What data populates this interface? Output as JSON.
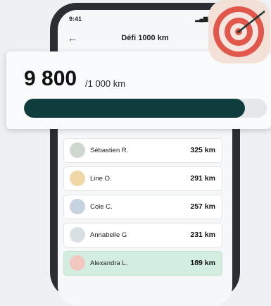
{
  "status": {
    "time": "9:41",
    "icons": "▂▄▆ ≋ ▭"
  },
  "nav": {
    "back": "←",
    "title": "Défi 1000 km"
  },
  "progress": {
    "value": "9 800",
    "total": "/1 000 km",
    "fill_fraction": 0.91
  },
  "leaderboard": [
    {
      "name": "Sébastien R.",
      "km": "325 km",
      "avatar_color": "#cfd8cf"
    },
    {
      "name": "Line O.",
      "km": "291 km",
      "avatar_color": "#f1d7a6"
    },
    {
      "name": "Cole C.",
      "km": "257 km",
      "avatar_color": "#c7d3e0"
    },
    {
      "name": "Annabelle G",
      "km": "231 km",
      "avatar_color": "#d8e0e4"
    },
    {
      "name": "Alexandra L.",
      "km": "189 km",
      "avatar_color": "#f2c7bf"
    }
  ],
  "colors": {
    "accent": "#0f3d3e",
    "highlight": "#d3ede0",
    "target_red": "#e2574c"
  }
}
